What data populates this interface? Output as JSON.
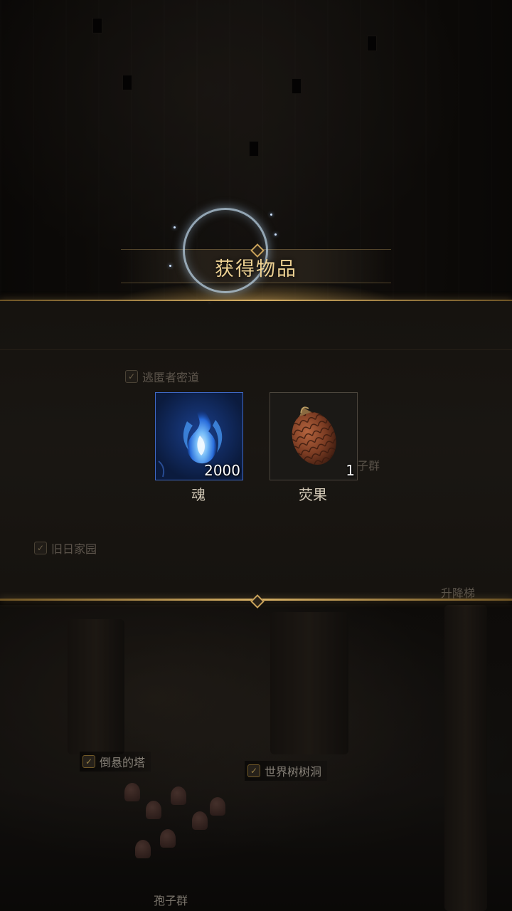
{
  "dialog": {
    "title": "获得物品",
    "items": [
      {
        "name": "魂",
        "quantity": "2000",
        "icon": "blue-soul-flame-icon"
      },
      {
        "name": "荧果",
        "quantity": "1",
        "icon": "pinecone-fruit-icon"
      }
    ]
  },
  "map": {
    "faded_labels": [
      "逃匿者密道",
      "旧日家园",
      "孢子群",
      "升降梯"
    ],
    "labels": [
      "倒悬的塔",
      "世界树树洞",
      "孢子群"
    ]
  },
  "colors": {
    "gold_accent": "#d7b065",
    "title_text": "#ecd092",
    "rare_frame": "#3f68c4"
  }
}
